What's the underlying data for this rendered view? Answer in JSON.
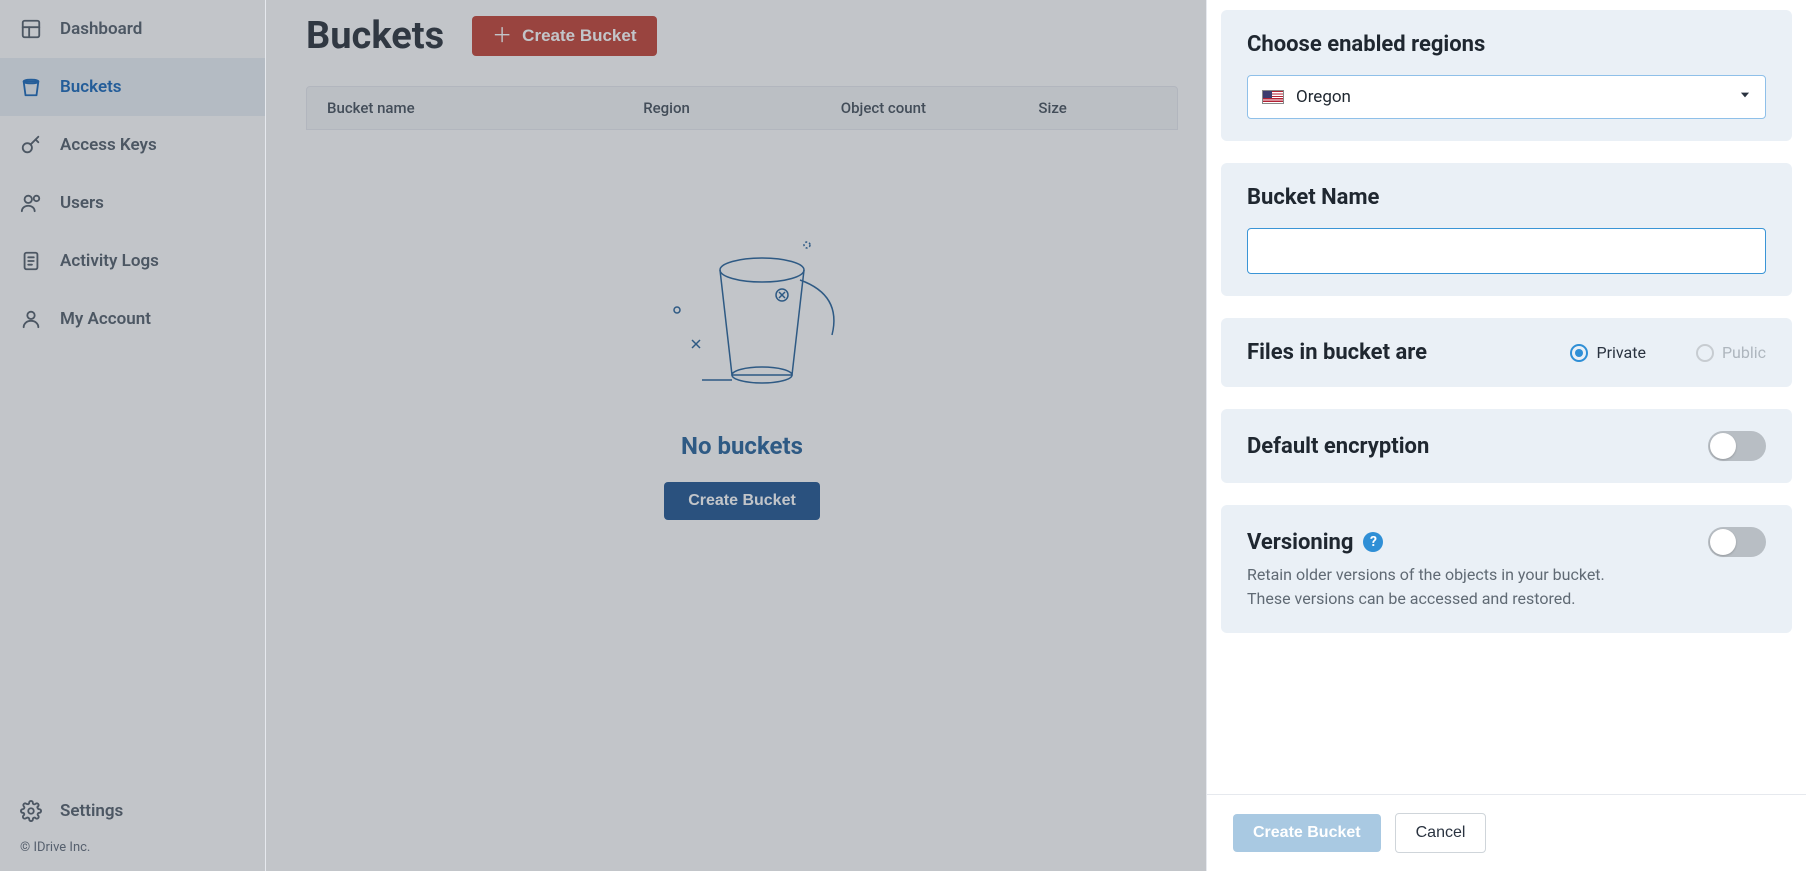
{
  "sidebar": {
    "items": [
      {
        "name": "dashboard",
        "label": "Dashboard"
      },
      {
        "name": "buckets",
        "label": "Buckets"
      },
      {
        "name": "access-keys",
        "label": "Access Keys"
      },
      {
        "name": "users",
        "label": "Users"
      },
      {
        "name": "activity-logs",
        "label": "Activity Logs"
      },
      {
        "name": "my-account",
        "label": "My Account"
      }
    ],
    "settings_label": "Settings",
    "copyright": "© IDrive Inc."
  },
  "main": {
    "page_title": "Buckets",
    "create_label": "Create Bucket",
    "table_headers": {
      "bucket_name": "Bucket name",
      "region": "Region",
      "object_count": "Object count",
      "size": "Size"
    },
    "empty_title": "No buckets",
    "empty_create_label": "Create Bucket"
  },
  "panel": {
    "region_title": "Choose enabled regions",
    "region_selected": "Oregon",
    "bucket_name_title": "Bucket Name",
    "bucket_name_value": "",
    "visibility_title": "Files in bucket are",
    "visibility_private": "Private",
    "visibility_public": "Public",
    "encryption_title": "Default encryption",
    "versioning_title": "Versioning",
    "versioning_desc_l1": "Retain older versions of the objects in your bucket.",
    "versioning_desc_l2": "These versions can be accessed and restored.",
    "submit_label": "Create Bucket",
    "cancel_label": "Cancel"
  }
}
